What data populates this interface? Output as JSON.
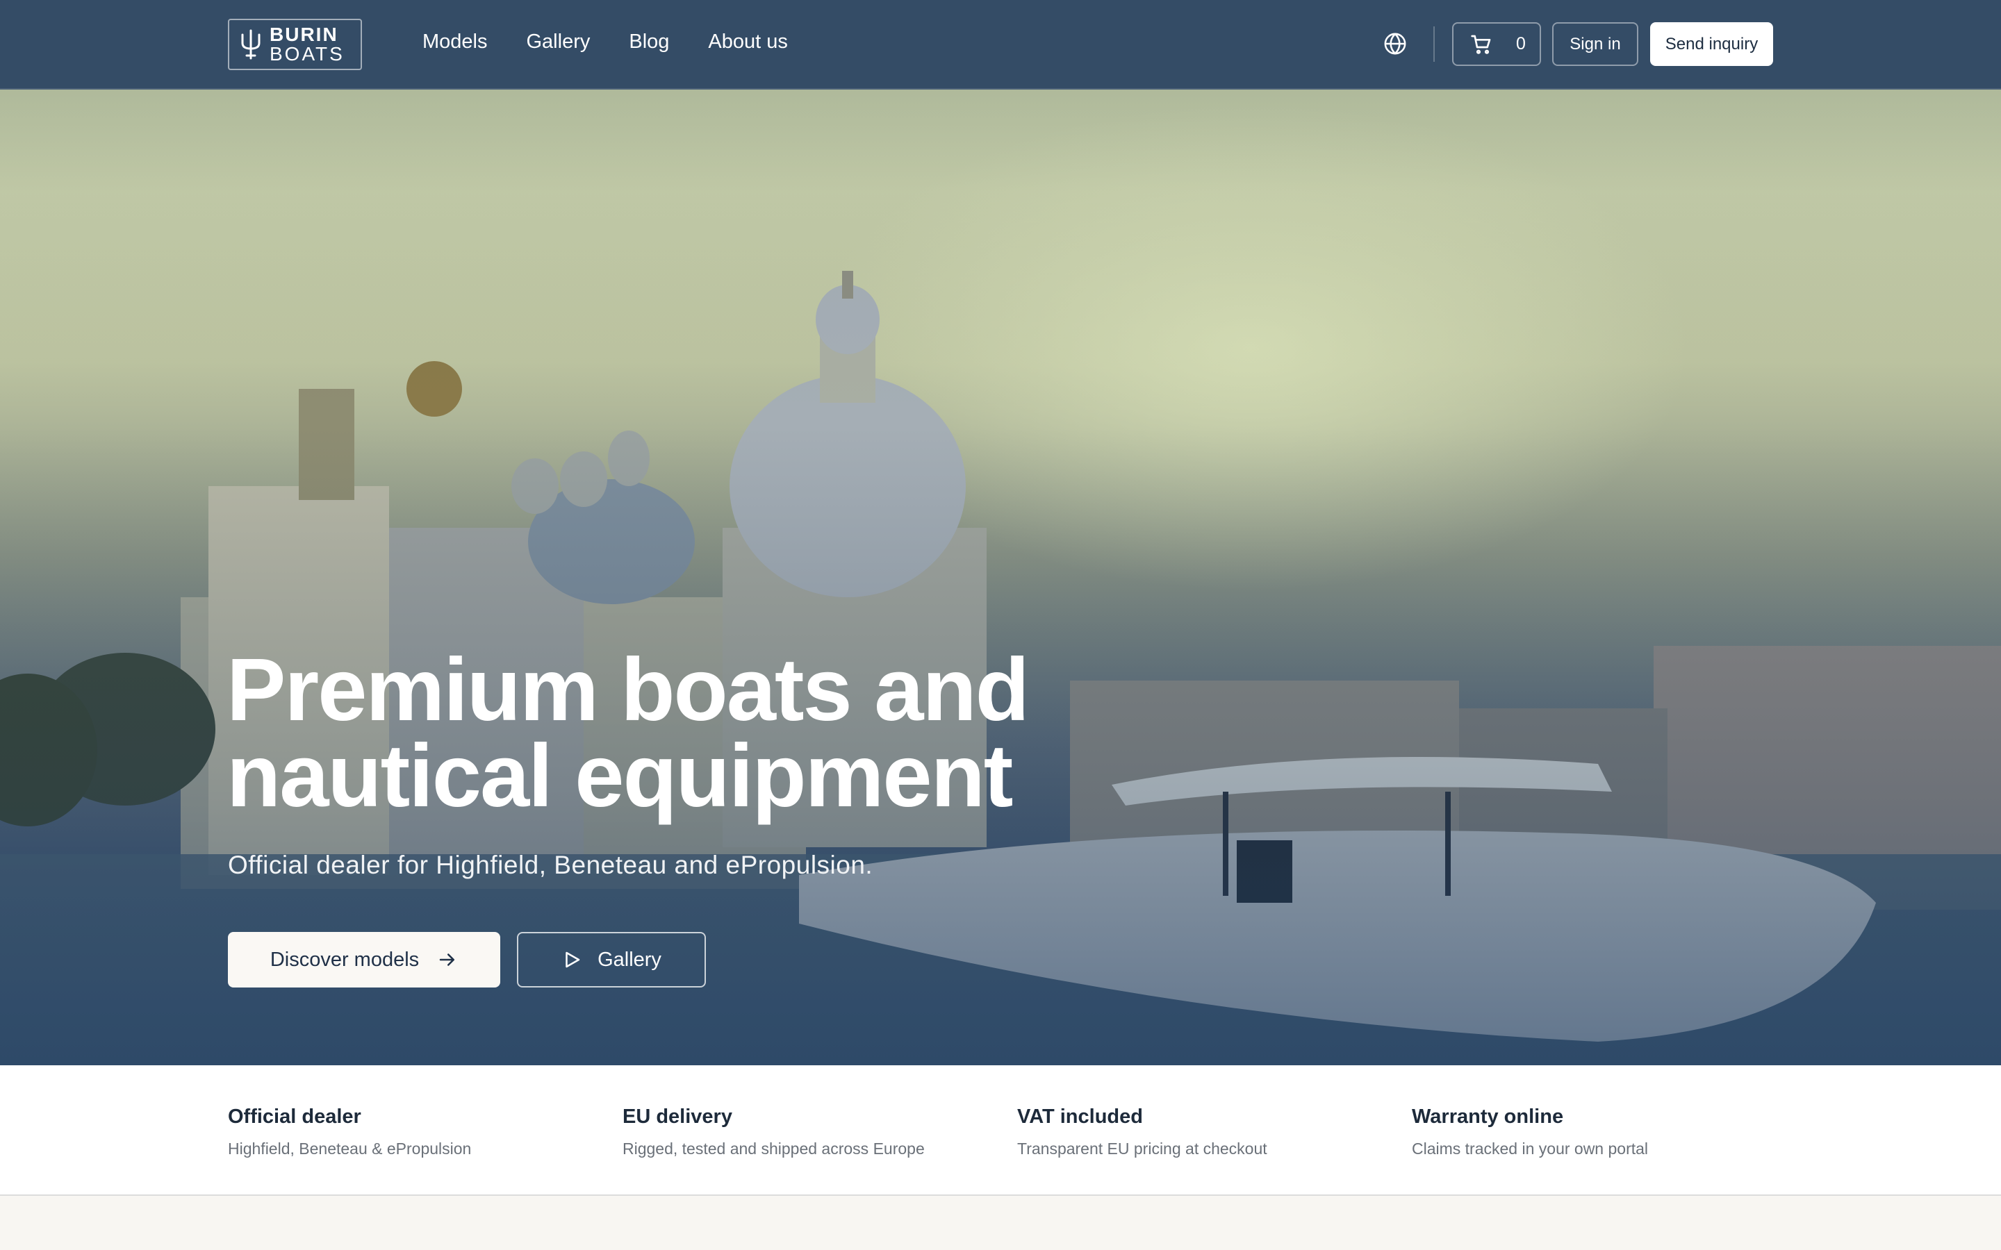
{
  "brand": {
    "line1": "BURIN",
    "line2": "BOATS",
    "logo_icon": "trident-icon"
  },
  "nav": {
    "links": [
      "Models",
      "Gallery",
      "Blog",
      "About us"
    ],
    "language_icon": "globe-icon",
    "cart": {
      "icon": "cart-icon",
      "count": "0"
    },
    "sign_in": "Sign in",
    "send_inquiry": "Send inquiry"
  },
  "hero": {
    "title_line1": "Premium boats and",
    "title_line2": "nautical equipment",
    "subtitle": "Official dealer for Highfield, Beneteau and ePropulsion.",
    "primary_cta": "Discover models",
    "secondary_cta": "Gallery"
  },
  "features": [
    {
      "title": "Official dealer",
      "desc": "Highfield, Beneteau & ePropulsion"
    },
    {
      "title": "EU delivery",
      "desc": "Rigged, tested and shipped across Europe"
    },
    {
      "title": "VAT included",
      "desc": "Transparent EU pricing at checkout"
    },
    {
      "title": "Warranty online",
      "desc": "Claims tracked in your own portal"
    }
  ],
  "colors": {
    "nav_bg": "#344c66",
    "page_bg": "#f8f6f2",
    "text_dark": "#1d2a3a"
  }
}
